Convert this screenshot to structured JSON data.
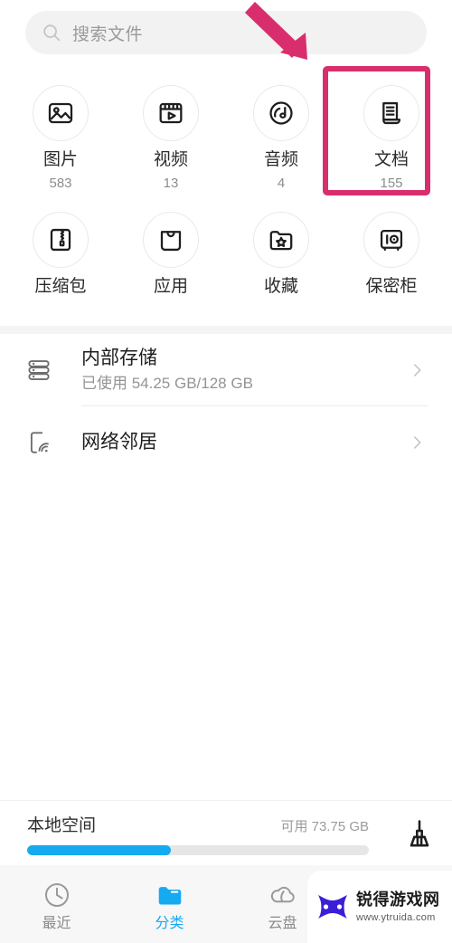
{
  "search": {
    "placeholder": "搜索文件",
    "icon": "search-icon"
  },
  "categories": [
    {
      "label": "图片",
      "count": "583",
      "icon": "image-icon"
    },
    {
      "label": "视频",
      "count": "13",
      "icon": "video-icon"
    },
    {
      "label": "音频",
      "count": "4",
      "icon": "audio-icon"
    },
    {
      "label": "文档",
      "count": "155",
      "icon": "document-icon",
      "highlighted": true
    },
    {
      "label": "压缩包",
      "count": "",
      "icon": "zip-icon"
    },
    {
      "label": "应用",
      "count": "",
      "icon": "apps-icon"
    },
    {
      "label": "收藏",
      "count": "",
      "icon": "favorite-folder-icon"
    },
    {
      "label": "保密柜",
      "count": "",
      "icon": "safe-icon"
    }
  ],
  "annotation": {
    "color": "#d92e6d",
    "arrow": "arrow-pointing-down-right",
    "target": "文档"
  },
  "storage_list": [
    {
      "title": "内部存储",
      "subtitle": "已使用 54.25 GB/128 GB",
      "icon": "internal-storage-icon",
      "chevron": "chevron-right-icon"
    },
    {
      "title": "网络邻居",
      "subtitle": "",
      "icon": "network-neighbor-icon",
      "chevron": "chevron-right-icon"
    }
  ],
  "local_space": {
    "label": "本地空间",
    "free_text": "可用 73.75 GB",
    "used_percent": 42,
    "bar_color": "#16aaf0",
    "clean_icon": "broom-clean-icon"
  },
  "bottom_nav": {
    "active_color": "#16aaf0",
    "items": [
      {
        "label": "最近",
        "icon": "clock-icon",
        "active": false
      },
      {
        "label": "分类",
        "icon": "folder-icon",
        "active": true
      },
      {
        "label": "云盘",
        "icon": "cloud-icon",
        "active": false
      },
      {
        "label": "",
        "icon": "person-icon",
        "active": false
      }
    ]
  },
  "watermark": {
    "title": "锐得游戏网",
    "url": "www.ytruida.com",
    "logo": "gamepad-logo-icon",
    "logo_color": "#3b1fd6"
  }
}
